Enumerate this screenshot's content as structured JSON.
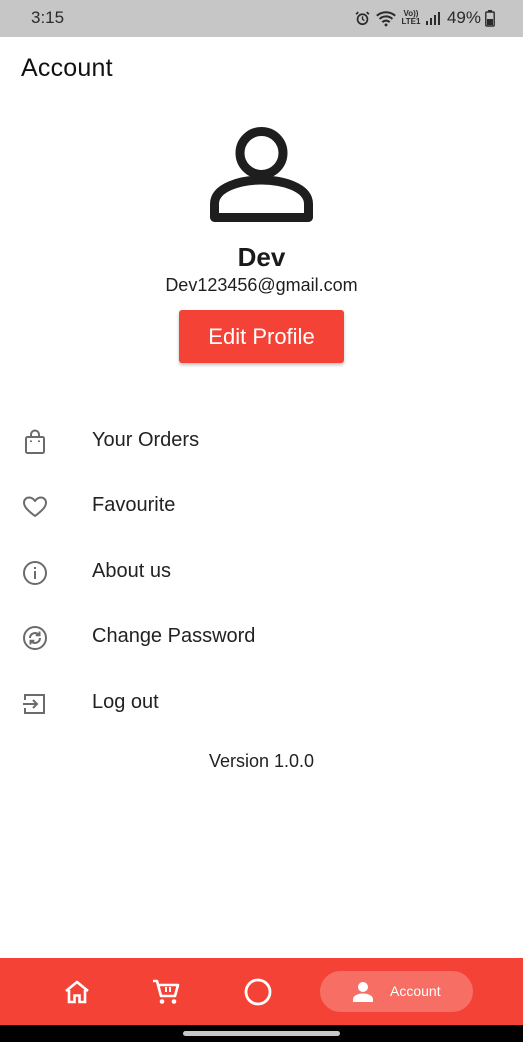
{
  "status_bar": {
    "time": "3:15",
    "network_label": "Vo)) LTE1",
    "battery": "49%"
  },
  "header": {
    "title": "Account"
  },
  "profile": {
    "avatar_icon": "person-outline-icon",
    "name": "Dev",
    "email": "Dev123456@gmail.com",
    "edit_button_label": "Edit Profile"
  },
  "menu": {
    "items": [
      {
        "label": "Your Orders",
        "icon": "shopping-bag-icon"
      },
      {
        "label": "Favourite",
        "icon": "heart-icon"
      },
      {
        "label": "About us",
        "icon": "info-icon"
      },
      {
        "label": "Change Password",
        "icon": "lock-reset-icon"
      },
      {
        "label": "Log out",
        "icon": "logout-icon"
      }
    ]
  },
  "version": "Version 1.0.0",
  "bottom_nav": {
    "items": [
      {
        "icon": "home-icon"
      },
      {
        "icon": "cart-icon"
      },
      {
        "icon": "circle-icon"
      },
      {
        "icon": "person-icon",
        "label": "Account",
        "active": true
      }
    ]
  },
  "colors": {
    "accent": "#f44336",
    "nav_active_pill": "#f66e64",
    "status_bar": "#c6c6c6",
    "icon_gray": "#6b6b6b"
  }
}
